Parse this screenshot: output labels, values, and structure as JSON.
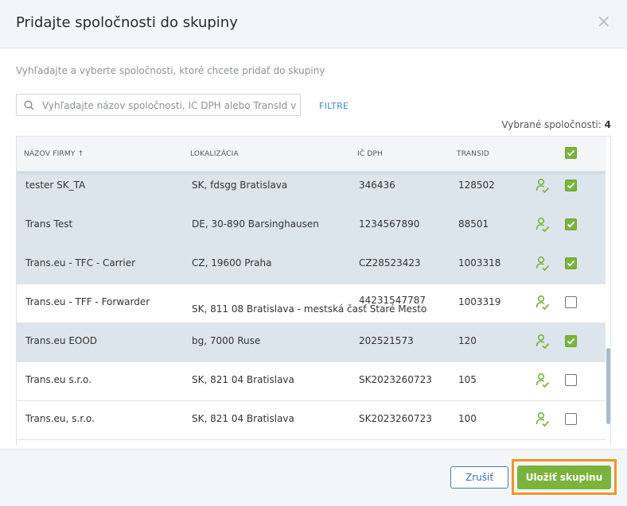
{
  "dialog": {
    "title": "Pridajte spoločnosti do skupiny",
    "close_symbol": "×",
    "subtitle": "Vyhľadajte a vyberte spoločnosti, ktoré chcete pridať do skupiny"
  },
  "search": {
    "placeholder": "Vyhľadajte názov spoločnosti, IČ DPH alebo TransId v dat...",
    "value": "",
    "icon": "search-icon"
  },
  "filters_label": "FILTRE",
  "selected": {
    "label": "Vybrané spoločnosti:",
    "count": "4"
  },
  "table": {
    "columns": {
      "name": "NÁZOV FIRMY ↑",
      "location": "LOKALIZÁCIA",
      "vat": "IČ DPH",
      "transid": "TRANSID"
    },
    "header_checkbox_checked": true,
    "rows": [
      {
        "name": "tester SK_TA",
        "location": "SK, fdsgg Bratislava",
        "vat": "346436",
        "transid": "128502",
        "checked": true
      },
      {
        "name": "Trans Test",
        "location": "DE, 30-890 Barsinghausen",
        "vat": "1234567890",
        "transid": "88501",
        "checked": true
      },
      {
        "name": "Trans.eu - TFC - Carrier",
        "location": "CZ, 19600 Praha",
        "vat": "CZ28523423",
        "transid": "1003318",
        "checked": true
      },
      {
        "name": "Trans.eu - TFF - Forwarder",
        "location": "SK, 811 08 Bratislava - mestská časť Staré Mesto",
        "vat": "44231547787",
        "transid": "1003319",
        "checked": false
      },
      {
        "name": "Trans.eu EOOD",
        "location": "bg, 7000 Ruse",
        "vat": "202521573",
        "transid": "120",
        "checked": true
      },
      {
        "name": "Trans.eu s.r.o.",
        "location": "SK, 821 04 Bratislava",
        "vat": "SK2023260723",
        "transid": "105",
        "checked": false
      },
      {
        "name": "Trans.eu, s.r.o.",
        "location": "SK, 821 04 Bratislava",
        "vat": "SK2023260723",
        "transid": "100",
        "checked": false
      }
    ]
  },
  "buttons": {
    "cancel": "Zrušiť",
    "save": "Uložiť skupinu"
  },
  "colors": {
    "accent_green": "#7ab43c",
    "link_blue": "#3c8dc8",
    "highlight_orange": "#f39325",
    "selected_row": "#dde5ec"
  }
}
